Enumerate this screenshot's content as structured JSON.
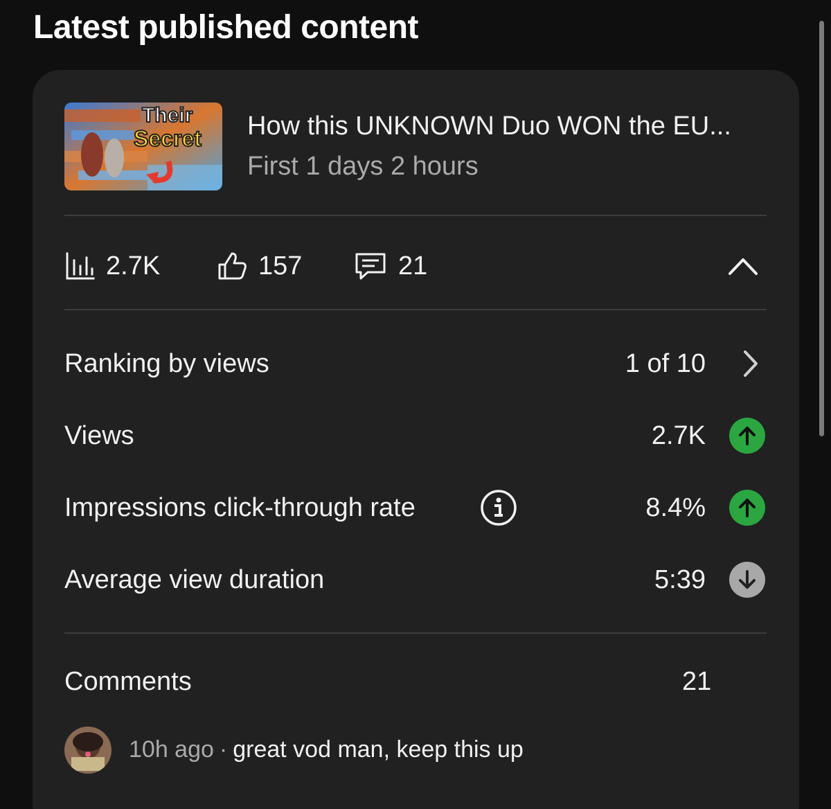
{
  "section": {
    "title": "Latest published content"
  },
  "video": {
    "thumbnail_text_line1": "Their",
    "thumbnail_text_line2": "Secret",
    "title": "How this UNKNOWN Duo WON the EU...",
    "meta": "First 1 days 2 hours"
  },
  "stats": {
    "views": "2.7K",
    "likes": "157",
    "comments": "21",
    "icons": [
      "bar-chart-icon",
      "thumbs-up-icon",
      "comment-icon",
      "chevron-up-icon"
    ]
  },
  "metrics": [
    {
      "label": "Ranking by views",
      "value": "1 of 10",
      "indicator": "chevron-right"
    },
    {
      "label": "Views",
      "value": "2.7K",
      "trend": "up"
    },
    {
      "label": "Impressions click-through rate",
      "value": "8.4%",
      "trend": "up",
      "has_info": true
    },
    {
      "label": "Average view duration",
      "value": "5:39",
      "trend": "down"
    }
  ],
  "comments": {
    "label": "Comments",
    "count": "21",
    "latest": {
      "time": "10h ago",
      "separator": "·",
      "text": "great vod man, keep this up"
    }
  },
  "colors": {
    "background": "#0f0f0f",
    "card": "#212121",
    "trend_up": "#2ba640",
    "trend_down": "#a8a8a8",
    "secondary_text": "#aaaaaa"
  }
}
